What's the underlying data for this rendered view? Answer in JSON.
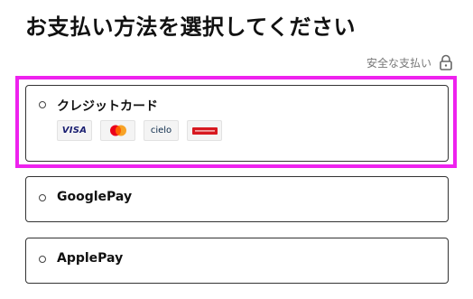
{
  "page": {
    "title": "お支払い方法を選択してください",
    "secure_label": "安全な支払い",
    "secure_icon": "lock-icon"
  },
  "payment_options": [
    {
      "label": "クレジットカード",
      "selected": false,
      "highlighted": true,
      "brands": [
        {
          "name": "visa-logo",
          "text": "VISA"
        },
        {
          "name": "mastercard-logo",
          "text": ""
        },
        {
          "name": "cielo-logo",
          "text": "cielo"
        },
        {
          "name": "card-brand-logo",
          "text": ""
        }
      ]
    },
    {
      "label": "GooglePay",
      "selected": false
    },
    {
      "label": "ApplePay",
      "selected": false
    }
  ],
  "colors": {
    "highlight": "#ee22ee",
    "border": "#333333",
    "muted_text": "#777777"
  }
}
